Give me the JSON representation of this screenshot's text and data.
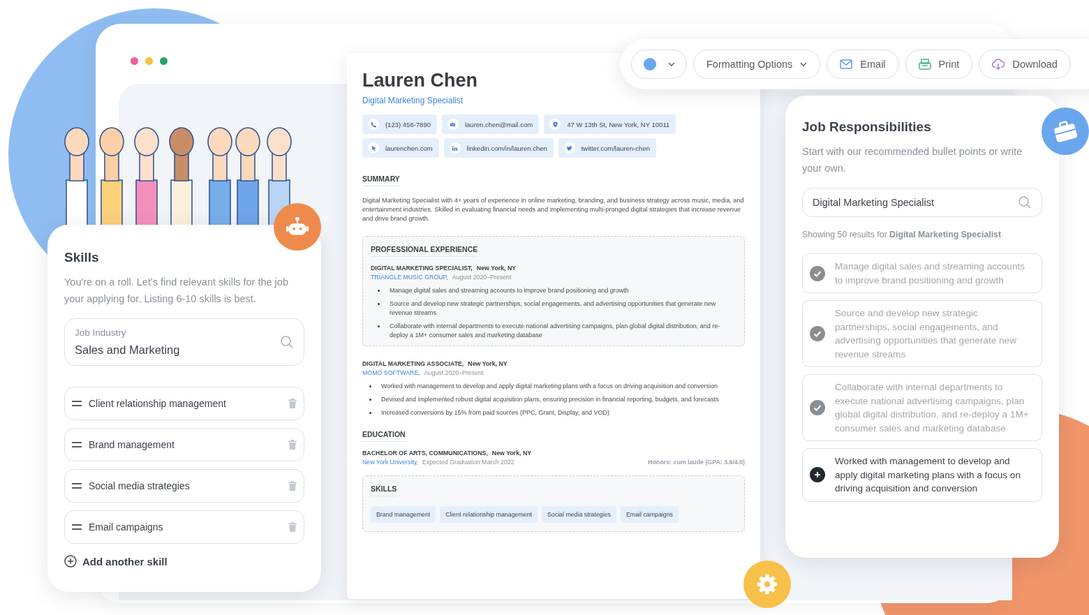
{
  "resume": {
    "name": "Lauren Chen",
    "title": "Digital Marketing Specialist",
    "contacts": [
      {
        "kind": "phone",
        "text": "(123) 456-7890"
      },
      {
        "kind": "email",
        "text": "lauren.chen@mail.com"
      },
      {
        "kind": "address",
        "text": "47 W 13th St, New York, NY 10011"
      },
      {
        "kind": "website",
        "text": "laurenchen.com"
      },
      {
        "kind": "linkedin",
        "text": "linkedin.com/in/lauren.chen"
      },
      {
        "kind": "twitter",
        "text": "twitter.com/lauren-chen"
      }
    ],
    "summary": {
      "heading": "SUMMARY",
      "text": "Digital Marketing Specialist with 4+ years of experience in online marketing, branding, and business strategy across music, media, and entertainment industries. Skilled in evaluating financial needs and implementing multi-pronged digital strategies that increase revenue and drive brand growth."
    },
    "experience": {
      "heading": "PROFESSIONAL EXPERIENCE",
      "jobs": [
        {
          "title": "DIGITAL MARKETING SPECIALIST,",
          "location": "New York, NY",
          "company": "TRIANGLE MUSIC GROUP,",
          "dates": "August 2020–Present",
          "highlighted": true,
          "bullets": [
            "Manage digital sales and streaming accounts to improve brand positioning and growth",
            "Source and develop new strategic partnerships, social engagements, and advertising opportunities that generate new revenue streams",
            "Collaborate with internal departments to execute national advertising campaigns, plan global digital distribution, and re-deploy a 1M+ consumer sales and marketing database"
          ]
        },
        {
          "title": "DIGITAL MARKETING ASSOCIATE,",
          "location": "New York, NY",
          "company": "MOMO SOFTWARE,",
          "dates": "August 2020–Present",
          "highlighted": false,
          "bullets": [
            "Worked with management to develop and apply digital marketing plans with a focus on driving acquisition and conversion",
            "Devised and implemented robust digital acquisition plans, ensuring precision in financial reporting, budgets, and forecasts",
            "Increased conversions by 15% from paid sources (PPC, Grant, Display, and VOD)"
          ]
        }
      ]
    },
    "education": {
      "heading": "EDUCATION",
      "degree": "BACHELOR OF ARTS, COMMUNICATIONS,",
      "location": "New York, NY",
      "school": "New York University,",
      "dates": "Expected Graduation March 2022",
      "honors": "Honors: cum laude (GPA: 3.6/4.0)"
    },
    "skills": {
      "heading": "SKILLS",
      "highlighted": true,
      "tags": [
        "Brand management",
        "Client relationship management",
        "Social media strategies",
        "Email campaigns"
      ]
    }
  },
  "toolbar": {
    "buttons": [
      {
        "kind": "dropdown",
        "label": "Formatting Options"
      },
      {
        "kind": "email",
        "label": "Email"
      },
      {
        "kind": "print",
        "label": "Print"
      },
      {
        "kind": "download",
        "label": "Download"
      }
    ]
  },
  "skills_panel": {
    "heading": "Skills",
    "description": "You're on a roll. Let's find relevant skills for the job your applying for. Listing 6-10 skills is best.",
    "field": {
      "label": "Job Industry",
      "value": "Sales and Marketing"
    },
    "items": [
      "Client relationship management",
      "Brand management",
      "Social media strategies",
      "Email campaigns"
    ],
    "add_label": "Add another skill"
  },
  "responsibilities_panel": {
    "heading": "Job Responsibilities",
    "description": "Start with our recommended bullet points or write your own.",
    "search_value": "Digital Marketing Specialist",
    "results_note": "Showing 50 results for **Digital Marketing Specialist**",
    "items": [
      {
        "text": "Manage digital sales and streaming accounts to improve brand positioning and growth",
        "added": true
      },
      {
        "text": "Source and develop new strategic partnerships, social engagements, and advertising opportunities that generate new revenue streams",
        "added": true
      },
      {
        "text": "Collaborate with internal departments to execute national advertising campaigns, plan global digital distribution, and re-deploy a 1M+ consumer sales and marketing database",
        "added": true
      },
      {
        "text": "Worked with management to develop and apply digital marketing plans with a focus on driving acquisition and conversion",
        "added": false
      }
    ]
  }
}
